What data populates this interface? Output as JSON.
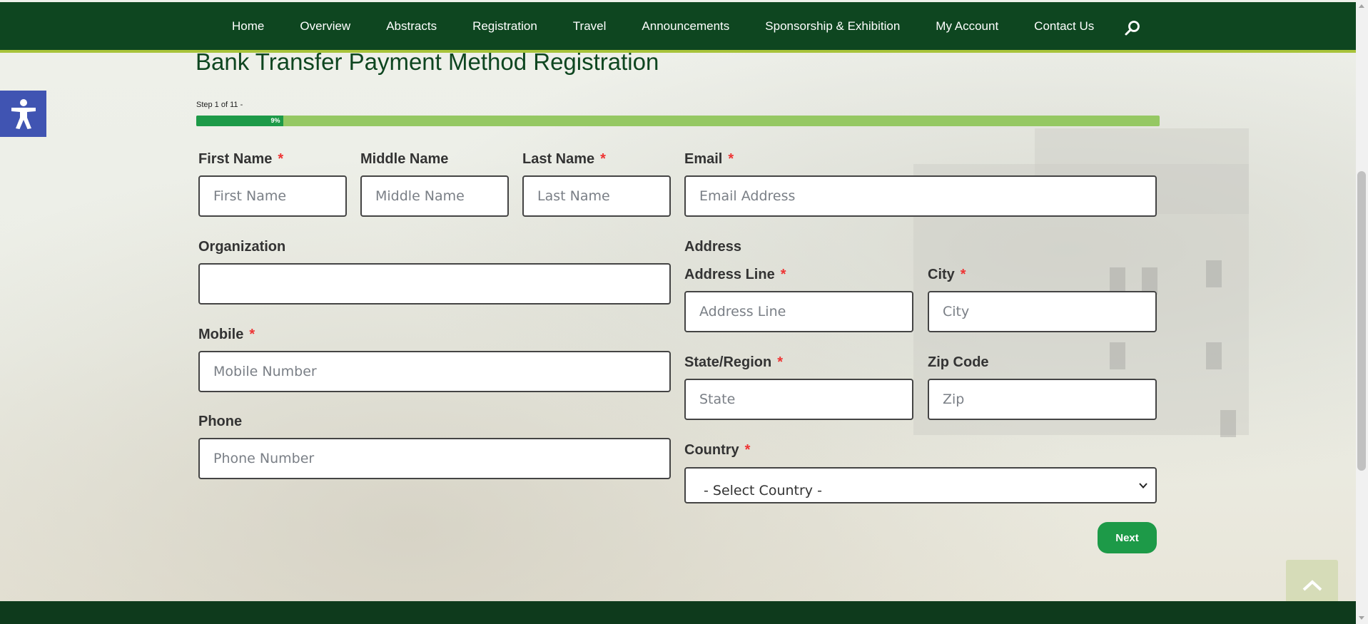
{
  "nav": {
    "items": [
      "Home",
      "Overview",
      "Abstracts",
      "Registration",
      "Travel",
      "Announcements",
      "Sponsorship & Exhibition",
      "My Account",
      "Contact Us"
    ],
    "search_icon": "search-icon"
  },
  "accessibility": {
    "icon": "accessibility-icon"
  },
  "form": {
    "title": "Bank Transfer Payment Method Registration",
    "step_text": "Step 1 of 11 -",
    "progress": {
      "percent": 9,
      "label": "9%"
    },
    "required_mark": "*",
    "first_name": {
      "label": "First Name",
      "placeholder": "First Name"
    },
    "middle_name": {
      "label": "Middle Name",
      "placeholder": "Middle Name"
    },
    "last_name": {
      "label": "Last Name",
      "placeholder": "Last Name"
    },
    "email": {
      "label": "Email",
      "placeholder": "Email Address"
    },
    "organization": {
      "label": "Organization",
      "placeholder": ""
    },
    "address_heading": "Address",
    "address_line": {
      "label": "Address Line",
      "placeholder": "Address Line"
    },
    "city": {
      "label": "City",
      "placeholder": "City"
    },
    "mobile": {
      "label": "Mobile",
      "placeholder": "Mobile Number"
    },
    "state": {
      "label": "State/Region",
      "placeholder": "State"
    },
    "zip": {
      "label": "Zip Code",
      "placeholder": "Zip"
    },
    "phone": {
      "label": "Phone",
      "placeholder": "Phone Number"
    },
    "country": {
      "label": "Country",
      "selected": "- Select Country -"
    },
    "next_label": "Next"
  },
  "colors": {
    "nav_bg": "#0e4620",
    "accent_line": "#a8c33a",
    "progress_fill": "#1d9a48",
    "progress_track": "#95c863",
    "required": "#ee3333",
    "accessibility_bg": "#4054b2"
  }
}
